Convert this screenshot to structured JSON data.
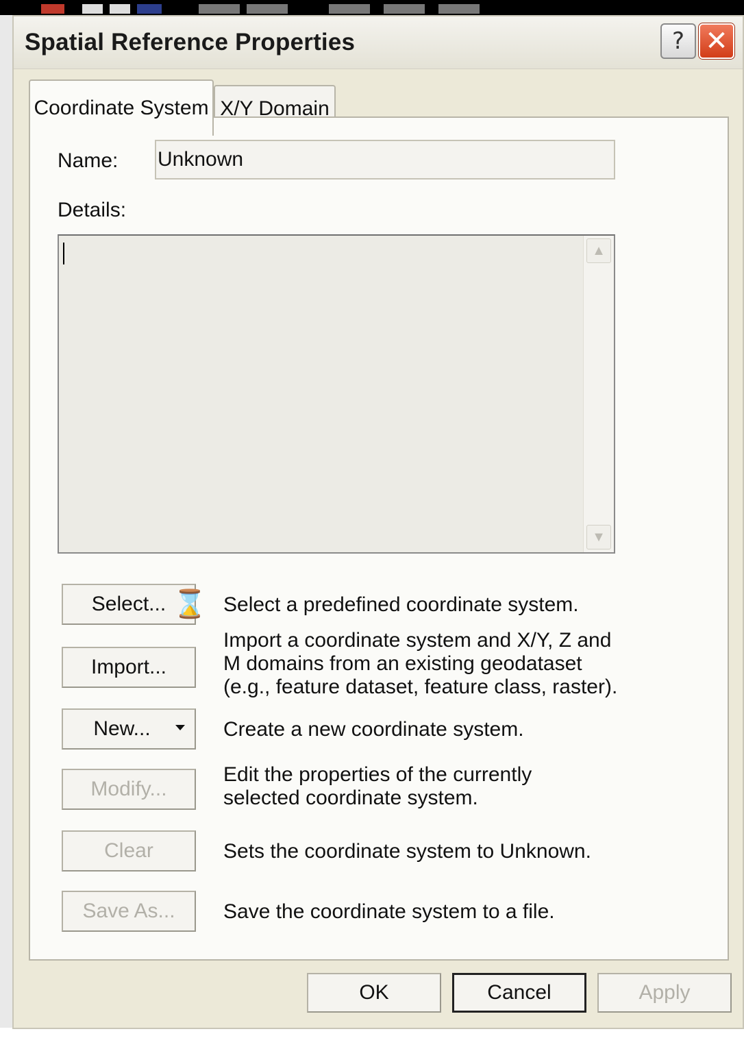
{
  "dialog": {
    "title": "Spatial Reference Properties",
    "help_label": "?",
    "close_label": "✕"
  },
  "tabs": [
    {
      "label": "Coordinate System",
      "active": true
    },
    {
      "label": "X/Y Domain",
      "active": false
    }
  ],
  "form": {
    "name_label": "Name:",
    "name_value": "Unknown",
    "details_label": "Details:",
    "details_value": ""
  },
  "actions": [
    {
      "label": "Select...",
      "description": "Select a predefined coordinate system.",
      "enabled": true
    },
    {
      "label": "Import...",
      "description": "Import a coordinate system and X/Y, Z and M domains from an existing geodataset (e.g., feature dataset, feature class, raster).",
      "enabled": true
    },
    {
      "label": "New...",
      "description": "Create a new coordinate system.",
      "enabled": true
    },
    {
      "label": "Modify...",
      "description": "Edit the properties of the currently selected coordinate system.",
      "enabled": false
    },
    {
      "label": "Clear",
      "description": "Sets the coordinate system to Unknown.",
      "enabled": false
    },
    {
      "label": "Save As...",
      "description": "Save the coordinate system to a file.",
      "enabled": false
    }
  ],
  "footer": {
    "ok_label": "OK",
    "cancel_label": "Cancel",
    "apply_label": "Apply"
  },
  "colors": {
    "dialog_bg": "#ece9d8",
    "close_button": "#d23d18",
    "disabled_text": "#b2b0a8"
  },
  "icons": {
    "busy_cursor": "hourglass-icon",
    "dropdown": "caret-down-icon"
  }
}
